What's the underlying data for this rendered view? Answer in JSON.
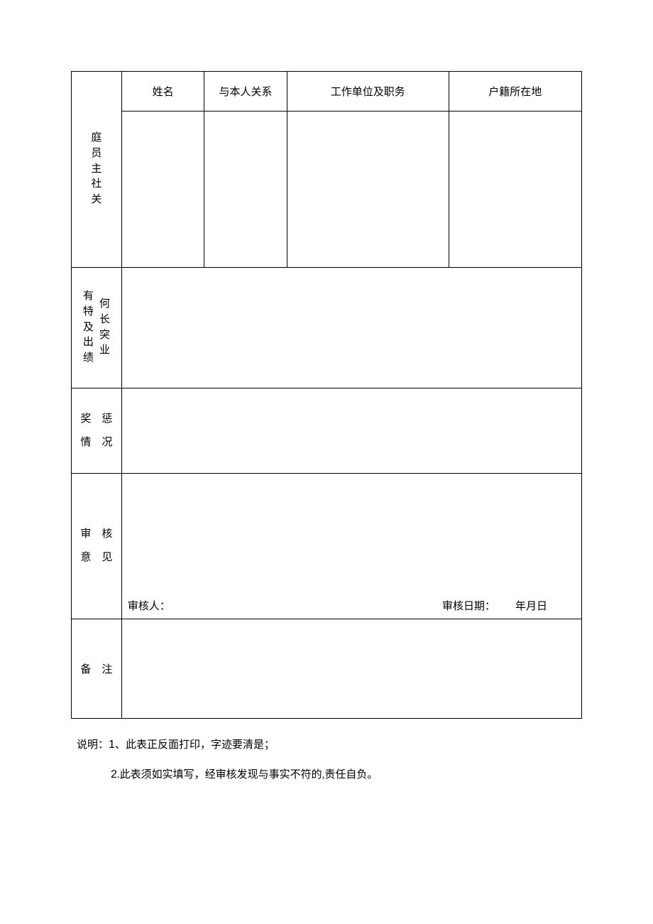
{
  "headers": {
    "name": "姓名",
    "relation": "与本人关系",
    "workplace": "工作单位及职务",
    "residence": "户籍所在地"
  },
  "rowLabels": {
    "family": {
      "col1": "庭员主社关",
      "col2": ""
    },
    "specialty": {
      "col1": "有特及出绩",
      "col2": "何长突业"
    },
    "rewards": {
      "line1": "奖　惩",
      "line2": "情　况"
    },
    "audit": {
      "line1": "审　核",
      "line2": "意　见"
    },
    "remark": "备　注"
  },
  "audit": {
    "auditorLabel": "审核人：",
    "dateLabel": "审核日期：",
    "dateValue": "年月日"
  },
  "notes": {
    "lead": "说明：",
    "n1num": "1",
    "n1sep": "、",
    "n1text": "此表正反面打印，字迹要清是；",
    "n2num": "2",
    "n2sep": ".",
    "n2text": "此表须如实填写，经审核发现与事实不符的,责任自负。"
  }
}
